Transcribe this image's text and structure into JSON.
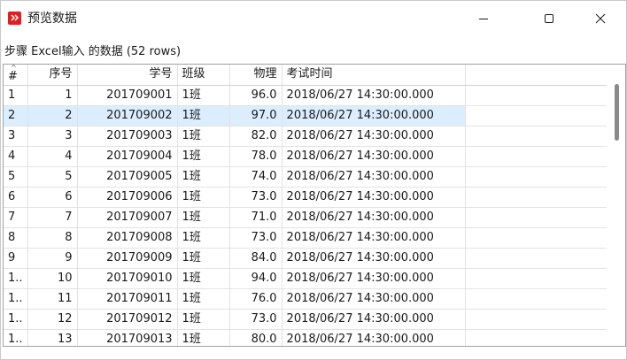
{
  "window": {
    "title": "预览数据",
    "subtitle": "步骤 Excel输入 的数据  (52 rows)"
  },
  "colors": {
    "icon_red": "#e02020",
    "selected_row": "#dbeeff"
  },
  "icons": {
    "app": "app-logo-icon",
    "minimize": "minimize-icon",
    "maximize": "maximize-icon",
    "close": "close-icon",
    "sort": "sort-caret-icon"
  },
  "table": {
    "columns": [
      "#",
      "序号",
      "学号",
      "班级",
      "物理",
      "考试时间"
    ],
    "selected_row": 1,
    "rows": [
      [
        "1",
        "1",
        "201709001",
        "1班",
        "96.0",
        "2018/06/27 14:30:00.000"
      ],
      [
        "2",
        "2",
        "201709002",
        "1班",
        "97.0",
        "2018/06/27 14:30:00.000"
      ],
      [
        "3",
        "3",
        "201709003",
        "1班",
        "82.0",
        "2018/06/27 14:30:00.000"
      ],
      [
        "4",
        "4",
        "201709004",
        "1班",
        "78.0",
        "2018/06/27 14:30:00.000"
      ],
      [
        "5",
        "5",
        "201709005",
        "1班",
        "74.0",
        "2018/06/27 14:30:00.000"
      ],
      [
        "6",
        "6",
        "201709006",
        "1班",
        "73.0",
        "2018/06/27 14:30:00.000"
      ],
      [
        "7",
        "7",
        "201709007",
        "1班",
        "71.0",
        "2018/06/27 14:30:00.000"
      ],
      [
        "8",
        "8",
        "201709008",
        "1班",
        "73.0",
        "2018/06/27 14:30:00.000"
      ],
      [
        "9",
        "9",
        "201709009",
        "1班",
        "84.0",
        "2018/06/27 14:30:00.000"
      ],
      [
        "1..",
        "10",
        "201709010",
        "1班",
        "94.0",
        "2018/06/27 14:30:00.000"
      ],
      [
        "1..",
        "11",
        "201709011",
        "1班",
        "76.0",
        "2018/06/27 14:30:00.000"
      ],
      [
        "1..",
        "12",
        "201709012",
        "1班",
        "73.0",
        "2018/06/27 14:30:00.000"
      ],
      [
        "1..",
        "13",
        "201709013",
        "1班",
        "80.0",
        "2018/06/27 14:30:00.000"
      ]
    ]
  }
}
